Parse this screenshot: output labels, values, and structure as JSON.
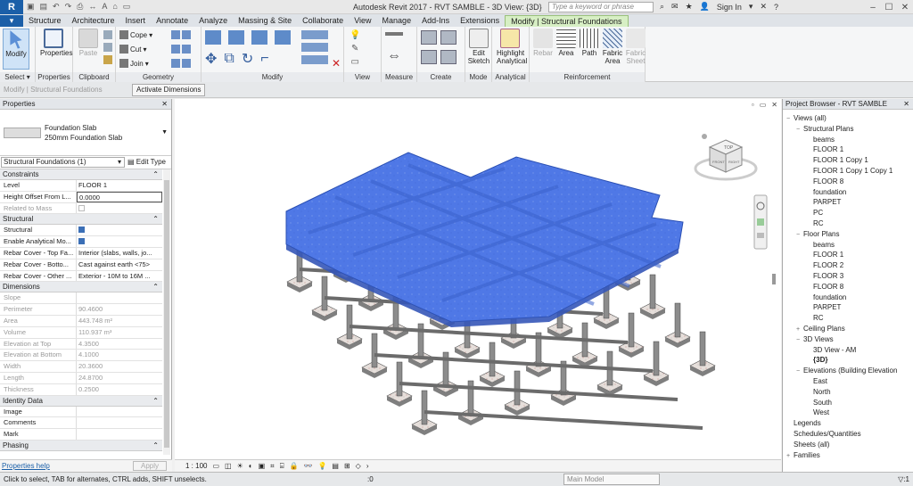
{
  "titlebar": {
    "app_letter": "R",
    "title": "Autodesk Revit 2017 -    RVT SAMBLE - 3D View: {3D}",
    "search_placeholder": "Type a keyword or phrase",
    "sign_in": "Sign In"
  },
  "tabs": [
    "Structure",
    "Architecture",
    "Insert",
    "Annotate",
    "Analyze",
    "Massing & Site",
    "Collaborate",
    "View",
    "Manage",
    "Add-Ins",
    "Extensions",
    "Modify | Structural Foundations"
  ],
  "ribbon": {
    "modify": "Modify",
    "properties": "Properties",
    "paste": "Paste",
    "cope": "Cope",
    "cut": "Cut",
    "join": "Join",
    "edit_sketch": "Edit Sketch",
    "highlight_analytical": "Highlight Analytical",
    "rebar": "Rebar",
    "area": "Area",
    "path": "Path",
    "fabric_area": "Fabric Area",
    "fabric_sheet": "Fabric Sheet",
    "panels": [
      "Select",
      "Properties",
      "Clipboard",
      "Geometry",
      "Modify",
      "View",
      "Measure",
      "Create",
      "Mode",
      "Analytical",
      "Reinforcement"
    ]
  },
  "options_bar": {
    "context": "Modify | Structural Foundations",
    "activate": "Activate Dimensions"
  },
  "properties": {
    "header": "Properties",
    "type_name1": "Foundation Slab",
    "type_name2": "250mm Foundation Slab",
    "instance": "Structural Foundations (1)",
    "edit_type": "Edit Type",
    "groups": [
      {
        "name": "Constraints",
        "rows": [
          {
            "k": "Level",
            "v": "FLOOR 1",
            "dim": false
          },
          {
            "k": "Height Offset From L...",
            "v": "0.0000",
            "dim": false,
            "edit": true
          },
          {
            "k": "Related to Mass",
            "v": "",
            "dim": true,
            "check": "off"
          }
        ]
      },
      {
        "name": "Structural",
        "rows": [
          {
            "k": "Structural",
            "v": "",
            "dim": false,
            "check": "on"
          },
          {
            "k": "Enable Analytical Mo...",
            "v": "",
            "dim": false,
            "check": "on"
          },
          {
            "k": "Rebar Cover - Top Fa...",
            "v": "Interior (slabs, walls, jo...",
            "dim": false
          },
          {
            "k": "Rebar Cover - Botto...",
            "v": "Cast against earth <75>",
            "dim": false
          },
          {
            "k": "Rebar Cover - Other ...",
            "v": "Exterior - 10M to 16M ...",
            "dim": false
          }
        ]
      },
      {
        "name": "Dimensions",
        "rows": [
          {
            "k": "Slope",
            "v": "",
            "dim": true
          },
          {
            "k": "Perimeter",
            "v": "90.4600",
            "dim": true
          },
          {
            "k": "Area",
            "v": "443.748 m²",
            "dim": true
          },
          {
            "k": "Volume",
            "v": "110.937 m³",
            "dim": true
          },
          {
            "k": "Elevation at Top",
            "v": "4.3500",
            "dim": true
          },
          {
            "k": "Elevation at Bottom",
            "v": "4.1000",
            "dim": true
          },
          {
            "k": "Width",
            "v": "20.3600",
            "dim": true
          },
          {
            "k": "Length",
            "v": "24.8700",
            "dim": true
          },
          {
            "k": "Thickness",
            "v": "0.2500",
            "dim": true
          }
        ]
      },
      {
        "name": "Identity Data",
        "rows": [
          {
            "k": "Image",
            "v": "",
            "dim": false
          },
          {
            "k": "Comments",
            "v": "",
            "dim": false
          },
          {
            "k": "Mark",
            "v": "",
            "dim": false
          }
        ]
      },
      {
        "name": "Phasing",
        "rows": []
      }
    ],
    "help": "Properties help",
    "apply": "Apply"
  },
  "canvas": {
    "scale": "1 : 100",
    "viewcube_top": "TOP",
    "viewcube_front": "FRONT",
    "viewcube_right": "RIGHT"
  },
  "browser": {
    "header": "Project Browser - RVT SAMBLE",
    "items": [
      {
        "t": "Views (all)",
        "lvl": 0,
        "tog": "−"
      },
      {
        "t": "Structural Plans",
        "lvl": 1,
        "tog": "−"
      },
      {
        "t": "beams",
        "lvl": 2
      },
      {
        "t": "FLOOR 1",
        "lvl": 2
      },
      {
        "t": "FLOOR 1 Copy 1",
        "lvl": 2
      },
      {
        "t": "FLOOR 1 Copy 1 Copy 1",
        "lvl": 2
      },
      {
        "t": "FLOOR 8",
        "lvl": 2
      },
      {
        "t": "foundation",
        "lvl": 2
      },
      {
        "t": "PARPET",
        "lvl": 2
      },
      {
        "t": "PC",
        "lvl": 2
      },
      {
        "t": "RC",
        "lvl": 2
      },
      {
        "t": "Floor Plans",
        "lvl": 1,
        "tog": "−"
      },
      {
        "t": "beams",
        "lvl": 2
      },
      {
        "t": "FLOOR 1",
        "lvl": 2
      },
      {
        "t": "FLOOR 2",
        "lvl": 2
      },
      {
        "t": "FLOOR 3",
        "lvl": 2
      },
      {
        "t": "FLOOR 8",
        "lvl": 2
      },
      {
        "t": "foundation",
        "lvl": 2
      },
      {
        "t": "PARPET",
        "lvl": 2
      },
      {
        "t": "RC",
        "lvl": 2
      },
      {
        "t": "Ceiling Plans",
        "lvl": 1,
        "tog": "+"
      },
      {
        "t": "3D Views",
        "lvl": 1,
        "tog": "−"
      },
      {
        "t": "3D View - AM",
        "lvl": 2
      },
      {
        "t": "{3D}",
        "lvl": 2,
        "bold": true
      },
      {
        "t": "Elevations (Building Elevation",
        "lvl": 1,
        "tog": "−"
      },
      {
        "t": "East",
        "lvl": 2
      },
      {
        "t": "North",
        "lvl": 2
      },
      {
        "t": "South",
        "lvl": 2
      },
      {
        "t": "West",
        "lvl": 2
      },
      {
        "t": "Legends",
        "lvl": 0
      },
      {
        "t": "Schedules/Quantities",
        "lvl": 0
      },
      {
        "t": "Sheets (all)",
        "lvl": 0
      },
      {
        "t": "Families",
        "lvl": 0,
        "tog": "+"
      }
    ]
  },
  "status": {
    "message": "Click to select, TAB for alternates, CTRL adds, SHIFT unselects.",
    "zero": ":0",
    "model": "Main Model",
    "filter": "▽:1"
  },
  "colors": {
    "slab": "#4f78e6",
    "ribbon_active": "#d7efc4",
    "file_tab": "#1b5fa8"
  }
}
